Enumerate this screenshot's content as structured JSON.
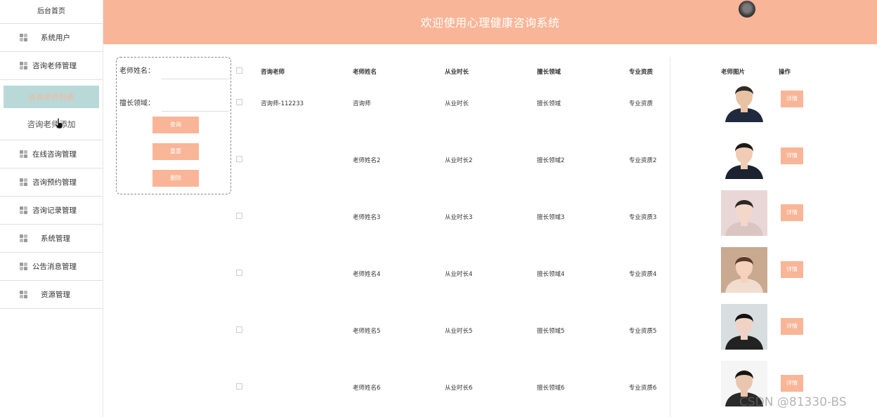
{
  "sidebar": {
    "home": "后台首页",
    "items": [
      {
        "label": "系统用户",
        "icon": "grid-icon"
      },
      {
        "label": "咨询老师管理",
        "icon": "grid-icon"
      },
      {
        "label": "在线咨询管理",
        "icon": "grid-icon"
      },
      {
        "label": "咨询预约管理",
        "icon": "grid-icon"
      },
      {
        "label": "咨询记录管理",
        "icon": "grid-icon"
      },
      {
        "label": "系统管理",
        "icon": "grid-icon"
      },
      {
        "label": "公告消息管理",
        "icon": "grid-icon"
      },
      {
        "label": "资源管理",
        "icon": "grid-icon"
      }
    ],
    "sub_active": "咨询老师列表",
    "sub_add": "咨询老师添加"
  },
  "header": {
    "title": "欢迎使用心理健康咨询系统"
  },
  "search": {
    "name_label": "老师姓名：",
    "field_label": "擅长领域：",
    "query_btn": "查询",
    "reset_btn": "重置",
    "delete_btn": "删除"
  },
  "table": {
    "columns": [
      "咨询老师",
      "老师姓名",
      "从业时长",
      "擅长领域",
      "专业资质",
      "老师图片",
      "操作"
    ],
    "detail_label": "详情",
    "rows": [
      {
        "teacher": "咨询师-112233",
        "name": "咨询师",
        "years": "从业时长",
        "field": "擅长领域",
        "qual": "专业资质"
      },
      {
        "teacher": "",
        "name": "老师姓名2",
        "years": "从业时长2",
        "field": "擅长领域2",
        "qual": "专业资质2"
      },
      {
        "teacher": "",
        "name": "老师姓名3",
        "years": "从业时长3",
        "field": "擅长领域3",
        "qual": "专业资质3"
      },
      {
        "teacher": "",
        "name": "老师姓名4",
        "years": "从业时长4",
        "field": "擅长领域4",
        "qual": "专业资质4"
      },
      {
        "teacher": "",
        "name": "老师姓名5",
        "years": "从业时长5",
        "field": "擅长领域5",
        "qual": "专业资质5"
      },
      {
        "teacher": "",
        "name": "老师姓名6",
        "years": "从业时长6",
        "field": "擅长领域6",
        "qual": "专业资质6"
      }
    ]
  },
  "watermark": "CSDN @81330-BS",
  "colors": {
    "accent": "#f9b597",
    "active_bg": "#b9d9d9"
  }
}
